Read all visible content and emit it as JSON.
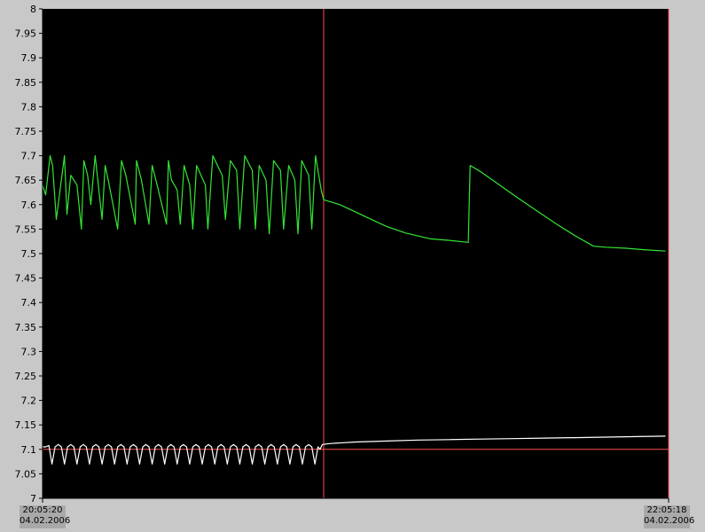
{
  "chart_data": {
    "type": "line",
    "ylim": [
      7,
      8
    ],
    "y_ticks": [
      "8",
      "7.95",
      "7.9",
      "7.85",
      "7.8",
      "7.75",
      "7.7",
      "7.65",
      "7.6",
      "7.55",
      "7.5",
      "7.45",
      "7.4",
      "7.35",
      "7.3",
      "7.25",
      "7.2",
      "7.15",
      "7.1",
      "7.05",
      "7"
    ],
    "x_start": {
      "time": "20:05:20",
      "date": "04.02.2006"
    },
    "x_end": {
      "time": "22:05:18",
      "date": "04.02.2006"
    },
    "grid": false,
    "background": "#000000",
    "series": [
      {
        "color": "#33e633",
        "x": [
          0,
          0.5,
          1.2,
          1.6,
          2.2,
          3.5,
          3.9,
          4.5,
          5.5,
          6.2,
          6.6,
          7.2,
          7.7,
          8.4,
          9.5,
          10.0,
          10.5,
          12.0,
          12.6,
          13.3,
          14.8,
          15.0,
          15.8,
          17.0,
          17.5,
          18.3,
          19.8,
          20.1,
          20.6,
          21.5,
          22.0,
          22.6,
          23.5,
          24.0,
          24.6,
          26.0,
          26.4,
          27.2,
          28.7,
          29.2,
          30.0,
          31.0,
          31.5,
          32.3,
          33.5,
          34.0,
          34.6,
          35.7,
          36.2,
          36.9,
          38.0,
          38.5,
          39.3,
          40.3,
          40.8,
          41.4,
          42.5,
          43.0,
          43.6,
          44.5,
          44.9,
          47.5,
          50.0,
          52.5,
          55.0,
          58.0,
          62.0,
          65.0,
          68.0,
          68.3,
          70.0,
          73.0,
          76.0,
          79.0,
          82.0,
          85.0,
          88.0,
          90.0,
          93.0,
          96.0,
          99.5
        ],
        "values": [
          7.64,
          7.62,
          7.7,
          7.68,
          7.57,
          7.7,
          7.58,
          7.66,
          7.64,
          7.55,
          7.69,
          7.66,
          7.6,
          7.7,
          7.57,
          7.68,
          7.65,
          7.55,
          7.69,
          7.66,
          7.56,
          7.69,
          7.65,
          7.56,
          7.68,
          7.64,
          7.56,
          7.69,
          7.65,
          7.63,
          7.56,
          7.68,
          7.64,
          7.55,
          7.68,
          7.64,
          7.55,
          7.7,
          7.66,
          7.57,
          7.69,
          7.67,
          7.55,
          7.7,
          7.67,
          7.55,
          7.68,
          7.65,
          7.54,
          7.69,
          7.67,
          7.55,
          7.68,
          7.65,
          7.54,
          7.69,
          7.66,
          7.55,
          7.7,
          7.63,
          7.61,
          7.6,
          7.585,
          7.57,
          7.555,
          7.542,
          7.53,
          7.527,
          7.523,
          7.68,
          7.667,
          7.64,
          7.613,
          7.587,
          7.561,
          7.537,
          7.515,
          7.513,
          7.511,
          7.508,
          7.505
        ]
      },
      {
        "color": "#ffffff",
        "x": [
          0,
          0.5,
          1.0,
          1.5,
          2.0,
          2.5,
          3.0,
          3.5,
          4.0,
          4.5,
          5.0,
          5.5,
          6.0,
          6.5,
          7.0,
          7.5,
          8.0,
          8.5,
          9.0,
          9.5,
          10.0,
          10.5,
          11.0,
          11.5,
          12.0,
          12.5,
          13.0,
          13.5,
          14.0,
          14.5,
          15.0,
          15.5,
          16.0,
          16.5,
          17.0,
          17.5,
          18.0,
          18.5,
          19.0,
          19.5,
          20.0,
          20.5,
          21.0,
          21.5,
          22.0,
          22.5,
          23.0,
          23.5,
          24.0,
          24.5,
          25.0,
          25.5,
          26.0,
          26.5,
          27.0,
          27.5,
          28.0,
          28.5,
          29.0,
          29.5,
          30.0,
          30.5,
          31.0,
          31.5,
          32.0,
          32.5,
          33.0,
          33.5,
          34.0,
          34.5,
          35.0,
          35.5,
          36.0,
          36.5,
          37.0,
          37.5,
          38.0,
          38.5,
          39.0,
          39.5,
          40.0,
          40.5,
          41.0,
          41.5,
          42.0,
          42.5,
          43.0,
          43.5,
          44.0,
          44.3,
          44.7,
          46.0,
          50.0,
          55.0,
          60.0,
          65.0,
          70.0,
          75.0,
          80.0,
          85.0,
          90.0,
          95.0,
          99.5
        ],
        "values": [
          7.105,
          7.105,
          7.108,
          7.07,
          7.105,
          7.11,
          7.105,
          7.07,
          7.105,
          7.11,
          7.105,
          7.07,
          7.105,
          7.11,
          7.105,
          7.07,
          7.105,
          7.11,
          7.105,
          7.07,
          7.105,
          7.11,
          7.105,
          7.07,
          7.105,
          7.11,
          7.105,
          7.07,
          7.105,
          7.11,
          7.105,
          7.07,
          7.105,
          7.11,
          7.105,
          7.07,
          7.105,
          7.11,
          7.105,
          7.07,
          7.105,
          7.11,
          7.105,
          7.07,
          7.105,
          7.11,
          7.105,
          7.07,
          7.105,
          7.11,
          7.105,
          7.07,
          7.105,
          7.11,
          7.105,
          7.07,
          7.105,
          7.11,
          7.105,
          7.07,
          7.105,
          7.11,
          7.105,
          7.07,
          7.105,
          7.11,
          7.105,
          7.07,
          7.105,
          7.11,
          7.105,
          7.07,
          7.105,
          7.11,
          7.105,
          7.07,
          7.105,
          7.11,
          7.105,
          7.07,
          7.105,
          7.11,
          7.105,
          7.07,
          7.105,
          7.11,
          7.105,
          7.07,
          7.105,
          7.1,
          7.11,
          7.112,
          7.115,
          7.117,
          7.119,
          7.12,
          7.121,
          7.122,
          7.123,
          7.124,
          7.125,
          7.126,
          7.127
        ]
      }
    ],
    "reference_lines": [
      {
        "type": "horizontal",
        "y": 7.1,
        "color": "#ff5050"
      },
      {
        "type": "vertical",
        "x": 44.9,
        "color": "#ff5050"
      },
      {
        "type": "vertical",
        "x": 100,
        "color": "#ff5050"
      }
    ]
  }
}
